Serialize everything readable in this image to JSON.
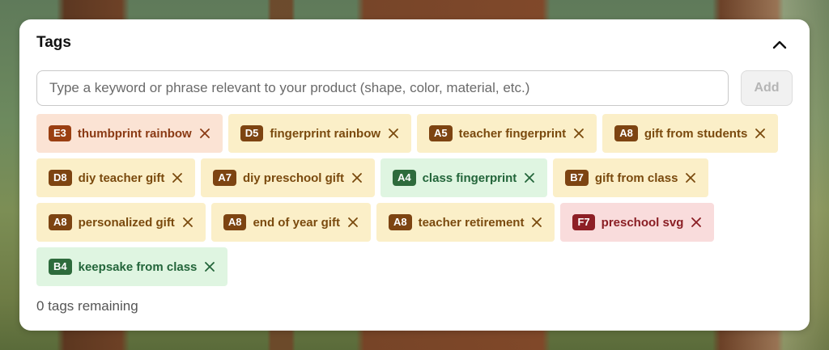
{
  "panel": {
    "title": "Tags",
    "collapse_icon": "chevron-up-icon"
  },
  "input": {
    "placeholder": "Type a keyword or phrase relevant to your product (shape, color, material, etc.)",
    "value": "",
    "add_label": "Add"
  },
  "colors": {
    "orange_bg": "#fbe3d4",
    "orange_text": "#8a3a14",
    "orange_badge": "#9a3f12",
    "yellow_bg": "#fbefc8",
    "yellow_text": "#7a4a0e",
    "yellow_badge": "#7d4412",
    "green_bg": "#dff5e1",
    "green_text": "#23653a",
    "green_badge": "#2e6b3c",
    "red_bg": "#f9dcdc",
    "red_text": "#8a1e24",
    "red_badge": "#8d1f25"
  },
  "tags": [
    [
      {
        "grade": "E3",
        "label": "thumbprint rainbow",
        "color": "orange",
        "remove_icon": "close-icon"
      },
      {
        "grade": "D5",
        "label": "fingerprint rainbow",
        "color": "yellow",
        "remove_icon": "close-icon"
      },
      {
        "grade": "A5",
        "label": "teacher fingerprint",
        "color": "yellow",
        "remove_icon": "close-icon"
      },
      {
        "grade": "A8",
        "label": "gift from students",
        "color": "yellow",
        "remove_icon": "close-icon"
      }
    ],
    [
      {
        "grade": "D8",
        "label": "diy teacher gift",
        "color": "yellow",
        "remove_icon": "close-icon"
      },
      {
        "grade": "A7",
        "label": "diy preschool gift",
        "color": "yellow",
        "remove_icon": "close-icon"
      },
      {
        "grade": "A4",
        "label": "class fingerprint",
        "color": "green",
        "remove_icon": "close-icon"
      },
      {
        "grade": "B7",
        "label": "gift from class",
        "color": "yellow",
        "remove_icon": "close-icon"
      }
    ],
    [
      {
        "grade": "A8",
        "label": "personalized gift",
        "color": "yellow",
        "remove_icon": "close-icon"
      },
      {
        "grade": "A8",
        "label": "end of year gift",
        "color": "yellow",
        "remove_icon": "close-icon"
      },
      {
        "grade": "A8",
        "label": "teacher retirement",
        "color": "yellow",
        "remove_icon": "close-icon"
      },
      {
        "grade": "F7",
        "label": "preschool svg",
        "color": "red",
        "remove_icon": "close-icon"
      }
    ],
    [
      {
        "grade": "B4",
        "label": "keepsake from class",
        "color": "green",
        "remove_icon": "close-icon"
      }
    ]
  ],
  "footer": {
    "remaining_text": "0 tags remaining"
  }
}
